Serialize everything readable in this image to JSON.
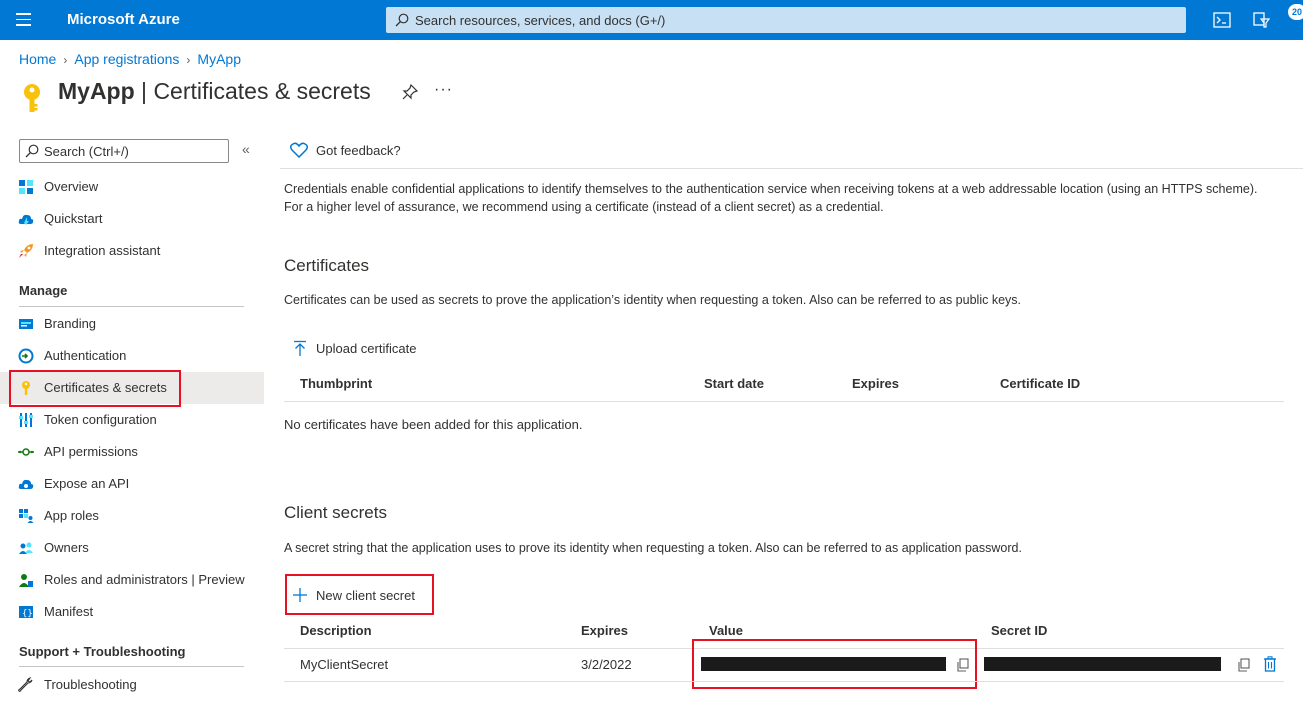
{
  "topbar": {
    "brand": "Microsoft Azure",
    "search_placeholder": "Search resources, services, and docs (G+/)",
    "notification_count": "20",
    "accent_color": "#0078d4"
  },
  "breadcrumb": [
    "Home",
    "App registrations",
    "MyApp"
  ],
  "title": {
    "app": "MyApp",
    "separator": " | ",
    "page": "Certificates & secrets"
  },
  "sidebar": {
    "search_placeholder": "Search (Ctrl+/)",
    "collapse_glyph": "«",
    "items_top": [
      {
        "label": "Overview",
        "icon": "overview-grid-icon"
      },
      {
        "label": "Quickstart",
        "icon": "quickstart-cloud-icon"
      },
      {
        "label": "Integration assistant",
        "icon": "rocket-icon"
      }
    ],
    "manage_heading": "Manage",
    "manage_items": [
      {
        "label": "Branding",
        "icon": "branding-icon"
      },
      {
        "label": "Authentication",
        "icon": "authentication-icon"
      },
      {
        "label": "Certificates & secrets",
        "icon": "key-icon",
        "selected": true
      },
      {
        "label": "Token configuration",
        "icon": "token-config-icon"
      },
      {
        "label": "API permissions",
        "icon": "api-permissions-icon"
      },
      {
        "label": "Expose an API",
        "icon": "expose-api-cloud-icon"
      },
      {
        "label": "App roles",
        "icon": "app-roles-icon"
      },
      {
        "label": "Owners",
        "icon": "owners-icon"
      },
      {
        "label": "Roles and administrators | Preview",
        "icon": "roles-admins-icon"
      },
      {
        "label": "Manifest",
        "icon": "manifest-icon"
      }
    ],
    "support_heading": "Support + Troubleshooting",
    "support_items": [
      {
        "label": "Troubleshooting",
        "icon": "wrench-icon"
      }
    ]
  },
  "main": {
    "feedback_label": "Got feedback?",
    "intro": "Credentials enable confidential applications to identify themselves to the authentication service when receiving tokens at a web addressable location (using an HTTPS scheme). For a higher level of assurance, we recommend using a certificate (instead of a client secret) as a credential.",
    "certificates": {
      "heading": "Certificates",
      "description": "Certificates can be used as secrets to prove the application’s identity when requesting a token. Also can be referred to as public keys.",
      "upload_label": "Upload certificate",
      "columns": [
        "Thumbprint",
        "Start date",
        "Expires",
        "Certificate ID"
      ],
      "empty_message": "No certificates have been added for this application."
    },
    "client_secrets": {
      "heading": "Client secrets",
      "description": "A secret string that the application uses to prove its identity when requesting a token. Also can be referred to as application password.",
      "new_label": "New client secret",
      "columns": [
        "Description",
        "Expires",
        "Value",
        "Secret ID"
      ],
      "rows": [
        {
          "description": "MyClientSecret",
          "expires": "3/2/2022",
          "value": "",
          "secret_id": ""
        }
      ]
    }
  }
}
